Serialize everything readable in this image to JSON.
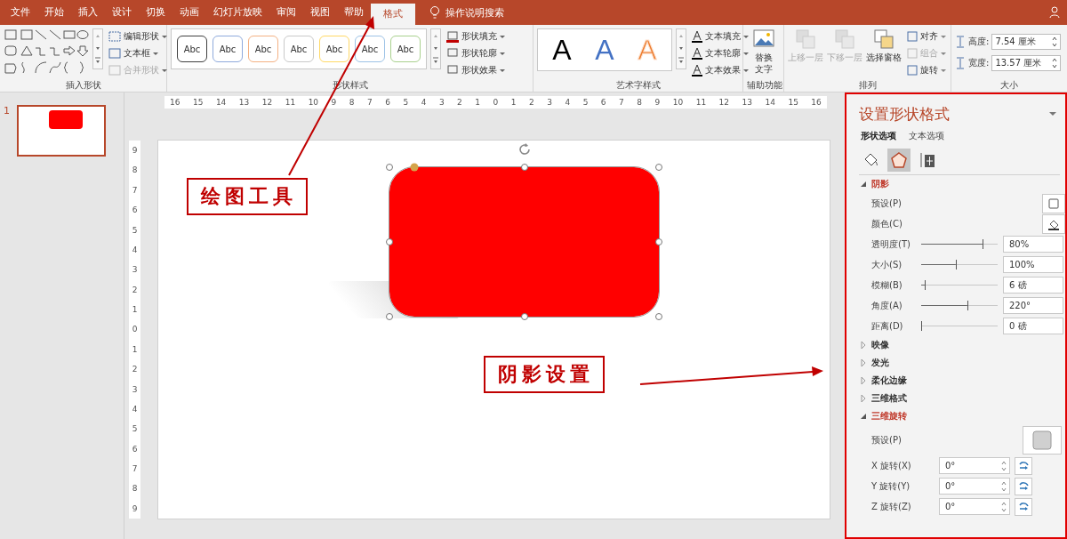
{
  "ribbon_tabs": [
    {
      "label": "文件",
      "selected": false
    },
    {
      "label": "开始",
      "selected": false
    },
    {
      "label": "插入",
      "selected": false
    },
    {
      "label": "设计",
      "selected": false
    },
    {
      "label": "切换",
      "selected": false
    },
    {
      "label": "动画",
      "selected": false
    },
    {
      "label": "幻灯片放映",
      "selected": false
    },
    {
      "label": "审阅",
      "selected": false
    },
    {
      "label": "视图",
      "selected": false
    },
    {
      "label": "帮助",
      "selected": false
    },
    {
      "label": "格式",
      "selected": true
    }
  ],
  "tell_me": "操作说明搜索",
  "ribbon": {
    "insert_shapes": {
      "commands": [
        {
          "label": "编辑形状",
          "disabled": false
        },
        {
          "label": "文本框",
          "disabled": false
        },
        {
          "label": "合并形状",
          "disabled": true
        }
      ],
      "group_label": "插入形状"
    },
    "shape_styles": {
      "previews": [
        {
          "label": "Abc",
          "color": "#404040"
        },
        {
          "label": "Abc",
          "color": "#8faadc"
        },
        {
          "label": "Abc",
          "color": "#f4b183"
        },
        {
          "label": "Abc",
          "color": "#c9c9c9"
        },
        {
          "label": "Abc",
          "color": "#ffd966"
        },
        {
          "label": "Abc",
          "color": "#9dc3e6"
        },
        {
          "label": "Abc",
          "color": "#a9d18e"
        }
      ],
      "commands": [
        "形状填充",
        "形状轮廓",
        "形状效果"
      ],
      "group_label": "形状样式"
    },
    "wordart": {
      "previews": [
        {
          "label": "A",
          "kind": "solid",
          "color": "#000000"
        },
        {
          "label": "A",
          "kind": "solid",
          "color": "#4472c4"
        },
        {
          "label": "A",
          "kind": "outline",
          "color": "#ed7d31"
        }
      ],
      "commands": [
        "文本填充",
        "文本轮廓",
        "文本效果"
      ],
      "group_label": "艺术字样式"
    },
    "accessibility": {
      "button": "替换文字",
      "group_label": "辅助功能"
    },
    "arrange": {
      "buttons": [
        {
          "label": "上移一层",
          "disabled": true
        },
        {
          "label": "下移一层",
          "disabled": true
        },
        {
          "label": "选择窗格",
          "disabled": false
        }
      ],
      "commands": [
        {
          "label": "对齐",
          "disabled": false
        },
        {
          "label": "组合",
          "disabled": true
        },
        {
          "label": "旋转",
          "disabled": false
        }
      ],
      "group_label": "排列"
    },
    "size": {
      "fields": [
        {
          "label": "高度:",
          "value": "7.54 厘米"
        },
        {
          "label": "宽度:",
          "value": "13.57 厘米"
        }
      ],
      "group_label": "大小"
    }
  },
  "slides": [
    {
      "number": "1",
      "selected": true
    }
  ],
  "rulers": {
    "horizontal": [
      "16",
      "15",
      "14",
      "13",
      "12",
      "11",
      "10",
      "9",
      "8",
      "7",
      "6",
      "5",
      "4",
      "3",
      "2",
      "1",
      "0",
      "1",
      "2",
      "3",
      "4",
      "5",
      "6",
      "7",
      "8",
      "9",
      "10",
      "11",
      "12",
      "13",
      "14",
      "15",
      "16"
    ],
    "vertical": [
      "9",
      "8",
      "7",
      "6",
      "5",
      "4",
      "3",
      "2",
      "1",
      "0",
      "1",
      "2",
      "3",
      "4",
      "5",
      "6",
      "7",
      "8",
      "9"
    ]
  },
  "slide": {
    "annotations": [
      {
        "text": "绘图工具"
      },
      {
        "text": "阴影设置"
      }
    ]
  },
  "format_pane": {
    "title": "设置形状格式",
    "tabs": [
      {
        "label": "形状选项",
        "selected": true
      },
      {
        "label": "文本选项",
        "selected": false
      }
    ],
    "icon_tabs": [
      {
        "kind": "fill",
        "selected": false
      },
      {
        "kind": "effects",
        "selected": true
      },
      {
        "kind": "size",
        "selected": false
      }
    ],
    "sections": [
      {
        "label": "阴影",
        "expanded": true,
        "rows": [
          {
            "kind": "preset",
            "label": "预设(P)"
          },
          {
            "kind": "color",
            "label": "颜色(C)"
          },
          {
            "kind": "slider",
            "label": "透明度(T)",
            "level": 0.8,
            "value": "80%"
          },
          {
            "kind": "slider",
            "label": "大小(S)",
            "level": 0.45,
            "value": "100%"
          },
          {
            "kind": "slider",
            "label": "模糊(B)",
            "level": 0.05,
            "value": "6 磅"
          },
          {
            "kind": "slider",
            "label": "角度(A)",
            "level": 0.6,
            "value": "220°"
          },
          {
            "kind": "slider",
            "label": "距离(D)",
            "level": 0,
            "value": "0 磅"
          }
        ]
      },
      {
        "label": "映像",
        "expanded": false
      },
      {
        "label": "发光",
        "expanded": false
      },
      {
        "label": "柔化边缘",
        "expanded": false
      },
      {
        "label": "三维格式",
        "expanded": false
      },
      {
        "label": "三维旋转",
        "expanded": true,
        "rows": [
          {
            "kind": "preset3d",
            "label": "预设(P)"
          },
          {
            "kind": "spin",
            "label": "X 旋转(X)",
            "value": "0°"
          },
          {
            "kind": "spin",
            "label": "Y 旋转(Y)",
            "value": "0°"
          },
          {
            "kind": "spin",
            "label": "Z 旋转(Z)",
            "value": "0°"
          }
        ]
      }
    ]
  }
}
